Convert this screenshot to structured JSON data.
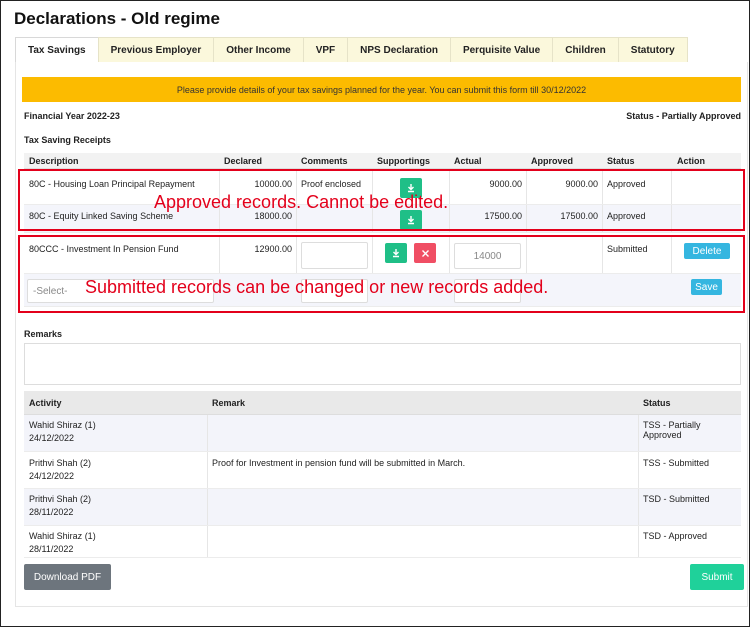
{
  "page": {
    "title": "Declarations - Old regime"
  },
  "tabs": [
    {
      "label": "Tax Savings",
      "active": true
    },
    {
      "label": "Previous Employer"
    },
    {
      "label": "Other Income"
    },
    {
      "label": "VPF"
    },
    {
      "label": "NPS Declaration"
    },
    {
      "label": "Perquisite Value"
    },
    {
      "label": "Children"
    },
    {
      "label": "Statutory"
    }
  ],
  "notice": "Please provide details of your tax savings planned for the year. You can submit this form till 30/12/2022",
  "financial_year": "Financial Year 2022-23",
  "overall_status": "Status - Partially Approved",
  "receipts": {
    "section_title": "Tax Saving Receipts",
    "columns": {
      "description": "Description",
      "declared": "Declared",
      "comments": "Comments",
      "supportings": "Supportings",
      "actual": "Actual",
      "approved": "Approved",
      "status": "Status",
      "action": "Action"
    },
    "rows": [
      {
        "description": "80C - Housing Loan Principal Repayment",
        "declared": "10000.00",
        "comments": "Proof enclosed",
        "actual": "9000.00",
        "approved": "9000.00",
        "status": "Approved"
      },
      {
        "description": "80C - Equity Linked Saving Scheme",
        "declared": "18000.00",
        "comments": "",
        "actual": "17500.00",
        "approved": "17500.00",
        "status": "Approved"
      },
      {
        "description": "80CCC - Investment In Pension Fund",
        "declared": "12900.00",
        "actual_input": "14000",
        "status": "Submitted",
        "action": "Delete"
      }
    ],
    "new_row": {
      "select_placeholder": "-Select-",
      "action": "Save"
    }
  },
  "callouts": {
    "approved": "Approved records. Cannot be edited.",
    "submitted": "Submitted records can be changed or new records added."
  },
  "remarks": {
    "label": "Remarks"
  },
  "activity": {
    "columns": {
      "activity": "Activity",
      "remark": "Remark",
      "status": "Status"
    },
    "rows": [
      {
        "name": "Wahid Shiraz (1)",
        "date": "24/12/2022",
        "remark": "",
        "status": "TSS - Partially Approved"
      },
      {
        "name": "Prithvi Shah (2)",
        "date": "24/12/2022",
        "remark": "Proof for Investment in pension fund will be submitted in March.",
        "status": "TSS - Submitted"
      },
      {
        "name": "Prithvi Shah (2)",
        "date": "28/11/2022",
        "remark": "",
        "status": "TSD - Submitted"
      },
      {
        "name": "Wahid Shiraz (1)",
        "date": "28/11/2022",
        "remark": "",
        "status": "TSD - Approved"
      }
    ]
  },
  "buttons": {
    "download_pdf": "Download PDF",
    "submit": "Submit"
  },
  "icons": {
    "download": "download-icon",
    "remove": "close-icon"
  },
  "colors": {
    "notice": "#fcbb00",
    "green": "#1fbf87",
    "red": "#f04e64",
    "blue": "#35b6e0",
    "callout": "#e3001b",
    "submit": "#1fd19a",
    "pdf": "#6d757d"
  }
}
